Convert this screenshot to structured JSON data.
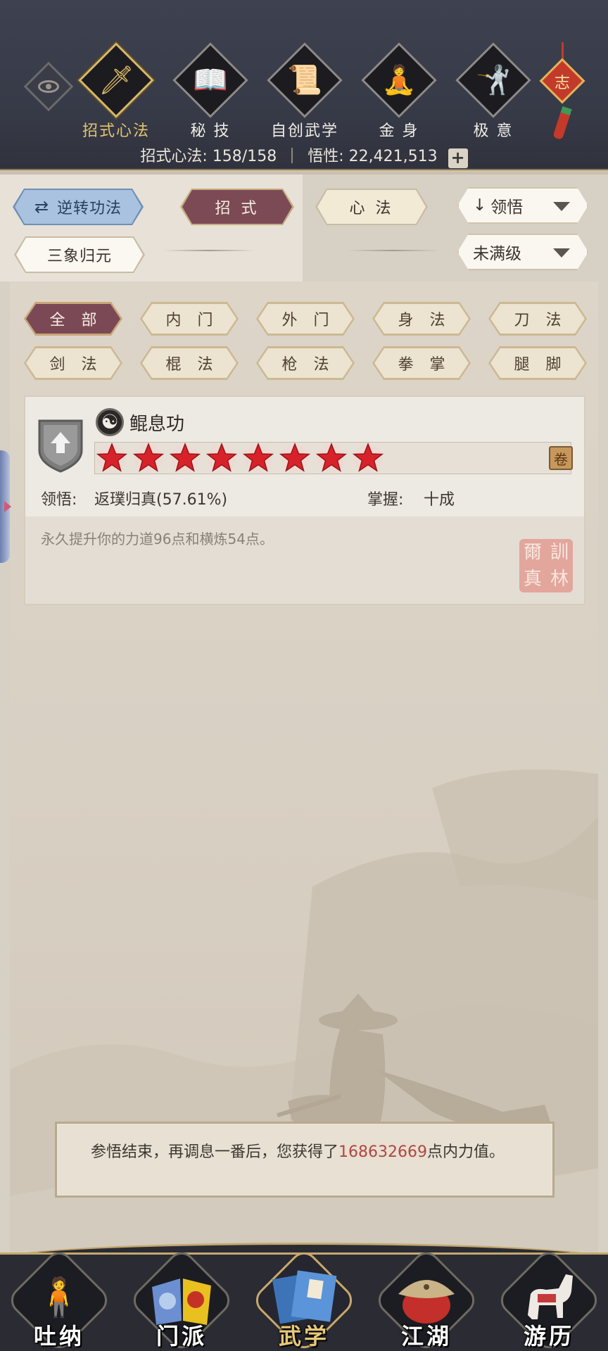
{
  "header": {
    "nav": [
      {
        "label": "招式心法",
        "icon": "sword-icon",
        "active": true
      },
      {
        "label": "秘 技",
        "icon": "book-icon",
        "active": false
      },
      {
        "label": "自创武学",
        "icon": "scroll-icon",
        "active": false
      },
      {
        "label": "金 身",
        "icon": "meditation-icon",
        "active": false
      },
      {
        "label": "极 意",
        "icon": "stance-icon",
        "active": false
      }
    ],
    "knot_char": "志",
    "stats": {
      "moves_label": "招式心法:",
      "moves_value": "158/158",
      "insight_label": "悟性:",
      "insight_value": "22,421,513",
      "plus": "+"
    }
  },
  "toolbar": {
    "reverse_label": "逆转功法",
    "tab_moves": "招 式",
    "tab_heart": "心 法",
    "sort_label": "领悟",
    "sanxiang_label": "三象归元",
    "level_filter": "未满级"
  },
  "filters": [
    "全 部",
    "内 门",
    "外 门",
    "身 法",
    "刀 法",
    "剑 法",
    "棍 法",
    "枪 法",
    "拳 掌",
    "腿 脚"
  ],
  "skill": {
    "name": "鲲息功",
    "stars": 8,
    "comprehension_label": "领悟:",
    "comprehension_value": "返璞归真(57.61%)",
    "mastery_label": "掌握:",
    "mastery_value": "十成",
    "description": "永久提升你的力道96点和横炼54点。",
    "seal_text": [
      "訓",
      "林",
      "爾",
      "真"
    ]
  },
  "message": {
    "prefix": "参悟结束，再调息一番后，您获得了",
    "amount": "168632669",
    "suffix": "点内力值。"
  },
  "bottom_nav": [
    {
      "label": "吐纳",
      "icon": "monk-icon",
      "active": false
    },
    {
      "label": "门派",
      "icon": "sect-banner-icon",
      "active": false
    },
    {
      "label": "武学",
      "icon": "manual-book-icon",
      "active": true
    },
    {
      "label": "江湖",
      "icon": "straw-hat-icon",
      "active": false
    },
    {
      "label": "游历",
      "icon": "horse-icon",
      "active": false
    }
  ],
  "colors": {
    "header_bg": "#363946",
    "accent_gold": "#e2c56e",
    "active_tab": "#7b4955",
    "star_red": "#d8222a",
    "highlight_number": "#b0473f"
  }
}
